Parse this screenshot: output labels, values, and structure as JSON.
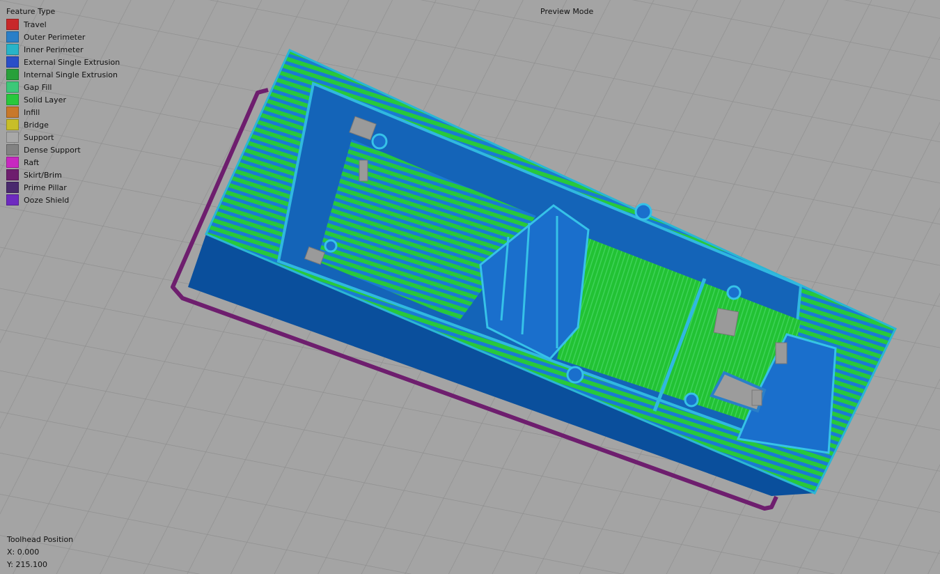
{
  "legend": {
    "title": "Feature Type",
    "items": [
      {
        "label": "Travel",
        "color": "#c8282a"
      },
      {
        "label": "Outer Perimeter",
        "color": "#2a7fc8"
      },
      {
        "label": "Inner Perimeter",
        "color": "#28b4c8"
      },
      {
        "label": "External Single Extrusion",
        "color": "#2a4fc8"
      },
      {
        "label": "Internal Single Extrusion",
        "color": "#28a03a"
      },
      {
        "label": "Gap Fill",
        "color": "#3cc878"
      },
      {
        "label": "Solid Layer",
        "color": "#28c83c"
      },
      {
        "label": "Infill",
        "color": "#c8782a"
      },
      {
        "label": "Bridge",
        "color": "#c8be28"
      },
      {
        "label": "Support",
        "color": "#a8a8a8"
      },
      {
        "label": "Dense Support",
        "color": "#828282"
      },
      {
        "label": "Raft",
        "color": "#c828c0"
      },
      {
        "label": "Skirt/Brim",
        "color": "#6e1e6e"
      },
      {
        "label": "Prime Pillar",
        "color": "#4a2a6e"
      },
      {
        "label": "Ooze Shield",
        "color": "#6e2ac0"
      }
    ]
  },
  "mode": "Preview Mode",
  "toolhead": {
    "title": "Toolhead Position",
    "x": "X: 0.000",
    "y": "Y: 215.100"
  },
  "colors": {
    "background": "#a4a4a4",
    "grid": "#8f8f8f",
    "model_side": "#0a4f9c",
    "model_top": "#1478d4",
    "infill_green": "#28c83c",
    "perimeter_cyan": "#28b4c8",
    "skirt": "#6e1e6e"
  }
}
